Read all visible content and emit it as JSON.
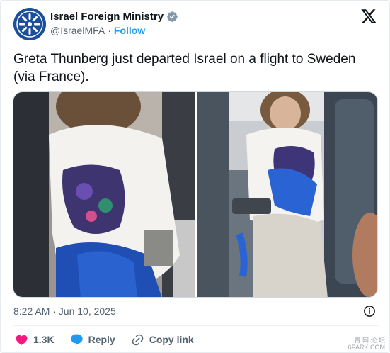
{
  "account": {
    "display_name": "Israel Foreign Ministry",
    "handle": "@IsraelMFA",
    "separator": "·",
    "follow_label": "Follow",
    "verified_color": "#829aab"
  },
  "tweet": {
    "text": "Greta Thunberg just departed Israel on a flight to Sweden (via France).",
    "timestamp": "8:22 AM · Jun 10, 2025"
  },
  "actions": {
    "like_count": "1.3K",
    "reply_label": "Reply",
    "copy_link_label": "Copy link"
  },
  "watermark": {
    "line1": "青 网 论 坛",
    "line2": "6PARK.COM"
  },
  "colors": {
    "brand_blue": "#1d9bf0",
    "like_pink": "#f91880",
    "secondary_text": "#536471"
  },
  "icons": [
    "verified-badge-icon",
    "x-logo-icon",
    "info-icon",
    "heart-icon",
    "reply-bubble-icon",
    "link-icon"
  ]
}
